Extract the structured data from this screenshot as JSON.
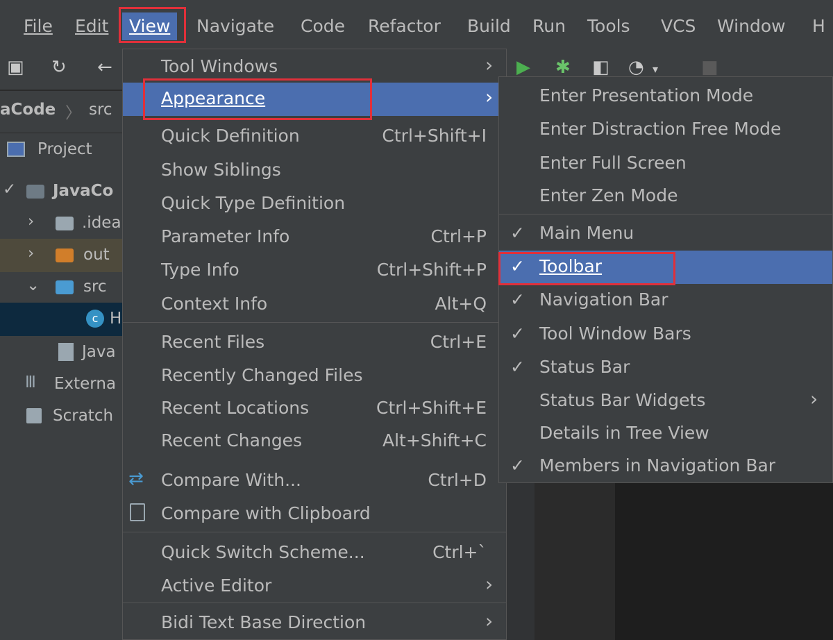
{
  "menubar": {
    "items": [
      "File",
      "Edit",
      "View",
      "Navigate",
      "Code",
      "Refactor",
      "Build",
      "Run",
      "Tools",
      "VCS",
      "Window",
      "H"
    ]
  },
  "navbar": {
    "project": "aCode",
    "folder": "src"
  },
  "project_panel": {
    "header": "Project",
    "rows": [
      "JavaCo",
      ".idea",
      "out",
      "src",
      "H",
      "Java",
      "Externa",
      "Scratch"
    ]
  },
  "view_menu": {
    "items": [
      {
        "label": "Tool Windows",
        "shortcut": "",
        "submenu": true
      },
      {
        "label": "Appearance",
        "shortcut": "",
        "submenu": true
      },
      {
        "label": "Quick Definition",
        "shortcut": "Ctrl+Shift+I"
      },
      {
        "label": "Show Siblings",
        "shortcut": ""
      },
      {
        "label": "Quick Type Definition",
        "shortcut": ""
      },
      {
        "label": "Parameter Info",
        "shortcut": "Ctrl+P"
      },
      {
        "label": "Type Info",
        "shortcut": "Ctrl+Shift+P"
      },
      {
        "label": "Context Info",
        "shortcut": "Alt+Q"
      },
      {
        "label": "Recent Files",
        "shortcut": "Ctrl+E"
      },
      {
        "label": "Recently Changed Files",
        "shortcut": ""
      },
      {
        "label": "Recent Locations",
        "shortcut": "Ctrl+Shift+E"
      },
      {
        "label": "Recent Changes",
        "shortcut": "Alt+Shift+C"
      },
      {
        "label": "Compare With...",
        "shortcut": "Ctrl+D"
      },
      {
        "label": "Compare with Clipboard",
        "shortcut": ""
      },
      {
        "label": "Quick Switch Scheme...",
        "shortcut": "Ctrl+`"
      },
      {
        "label": "Active Editor",
        "shortcut": "",
        "submenu": true
      },
      {
        "label": "Bidi Text Base Direction",
        "shortcut": "",
        "submenu": true
      }
    ]
  },
  "appearance_menu": {
    "items": [
      {
        "label": "Enter Presentation Mode",
        "checked": false
      },
      {
        "label": "Enter Distraction Free Mode",
        "checked": false
      },
      {
        "label": "Enter Full Screen",
        "checked": false
      },
      {
        "label": "Enter Zen Mode",
        "checked": false
      },
      {
        "label": "Main Menu",
        "checked": true
      },
      {
        "label": "Toolbar",
        "checked": true
      },
      {
        "label": "Navigation Bar",
        "checked": true
      },
      {
        "label": "Tool Window Bars",
        "checked": true
      },
      {
        "label": "Status Bar",
        "checked": true
      },
      {
        "label": "Status Bar Widgets",
        "checked": false,
        "submenu": true
      },
      {
        "label": "Details in Tree View",
        "checked": false
      },
      {
        "label": "Members in Navigation Bar",
        "checked": true
      }
    ],
    "check_glyph": "✓"
  },
  "colors": {
    "selection": "#4b6eaf",
    "highlight_box": "#e0303a",
    "menu_bg": "#3c3f41"
  }
}
